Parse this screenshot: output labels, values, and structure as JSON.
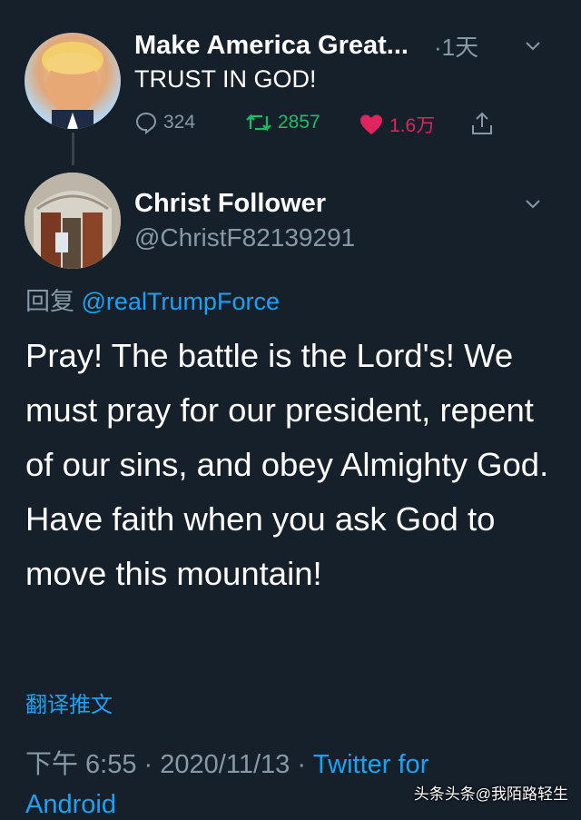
{
  "parent_tweet": {
    "name": "Make America Great...",
    "time": "·1天",
    "text": "TRUST IN GOD!",
    "actions": {
      "reply_count": "324",
      "retweet_count": "2857",
      "like_count": "1.6万"
    }
  },
  "reply_tweet": {
    "name": "Christ Follower",
    "handle": "@ChristF82139291",
    "reply_prefix": "回复",
    "reply_mention": "@realTrumpForce",
    "text": "Pray! The battle is the Lord's! We must pray for our president, repent of our sins, and obey Almighty God. Have faith when you ask God to move this mountain!",
    "translate_label": "翻译推文",
    "timestamp": "下午 6:55 · 2020/11/13 · ",
    "source": "Twitter for",
    "source_cont": "Android"
  },
  "watermark": "头条头条@我陌路轻生",
  "colors": {
    "background": "#15202b",
    "secondary_text": "#8899a6",
    "link": "#1da1f2",
    "retweet": "#17bf63",
    "like": "#e0245e"
  },
  "icons": [
    "reply-icon",
    "retweet-icon",
    "like-icon",
    "share-icon",
    "chevron-down-icon"
  ]
}
